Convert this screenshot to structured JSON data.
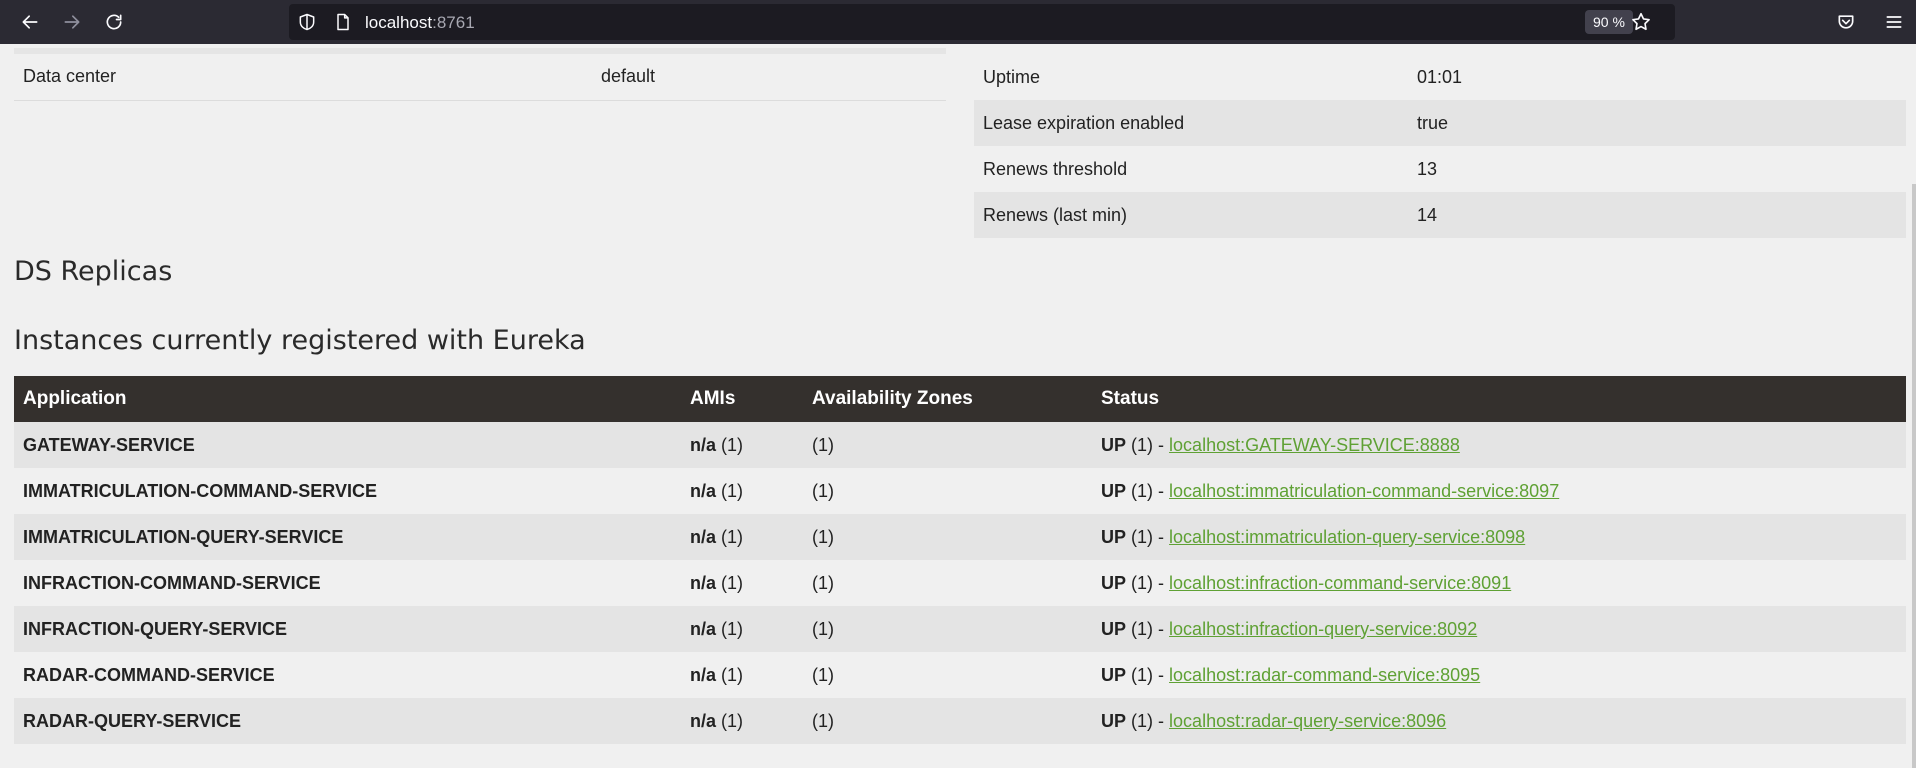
{
  "browser": {
    "url_host": "localhost",
    "url_port": ":8761",
    "zoom": "90 %"
  },
  "info_left": [
    {
      "label": "Data center",
      "value": "default"
    }
  ],
  "info_right": [
    {
      "label": "Uptime",
      "value": "01:01"
    },
    {
      "label": "Lease expiration enabled",
      "value": "true"
    },
    {
      "label": "Renews threshold",
      "value": "13"
    },
    {
      "label": "Renews (last min)",
      "value": "14"
    }
  ],
  "headings": {
    "ds_replicas": "DS Replicas",
    "instances": "Instances currently registered with Eureka"
  },
  "instances_table": {
    "columns": [
      "Application",
      "AMIs",
      "Availability Zones",
      "Status"
    ],
    "rows": [
      {
        "app": "GATEWAY-SERVICE",
        "ami_label": "n/a",
        "ami_count": "(1)",
        "zones": "(1)",
        "status": "UP",
        "status_count": "(1) -",
        "link": "localhost:GATEWAY-SERVICE:8888"
      },
      {
        "app": "IMMATRICULATION-COMMAND-SERVICE",
        "ami_label": "n/a",
        "ami_count": "(1)",
        "zones": "(1)",
        "status": "UP",
        "status_count": "(1) -",
        "link": "localhost:immatriculation-command-service:8097"
      },
      {
        "app": "IMMATRICULATION-QUERY-SERVICE",
        "ami_label": "n/a",
        "ami_count": "(1)",
        "zones": "(1)",
        "status": "UP",
        "status_count": "(1) -",
        "link": "localhost:immatriculation-query-service:8098"
      },
      {
        "app": "INFRACTION-COMMAND-SERVICE",
        "ami_label": "n/a",
        "ami_count": "(1)",
        "zones": "(1)",
        "status": "UP",
        "status_count": "(1) -",
        "link": "localhost:infraction-command-service:8091"
      },
      {
        "app": "INFRACTION-QUERY-SERVICE",
        "ami_label": "n/a",
        "ami_count": "(1)",
        "zones": "(1)",
        "status": "UP",
        "status_count": "(1) -",
        "link": "localhost:infraction-query-service:8092"
      },
      {
        "app": "RADAR-COMMAND-SERVICE",
        "ami_label": "n/a",
        "ami_count": "(1)",
        "zones": "(1)",
        "status": "UP",
        "status_count": "(1) -",
        "link": "localhost:radar-command-service:8095"
      },
      {
        "app": "RADAR-QUERY-SERVICE",
        "ami_label": "n/a",
        "ami_count": "(1)",
        "zones": "(1)",
        "status": "UP",
        "status_count": "(1) -",
        "link": "localhost:radar-query-service:8096"
      }
    ]
  }
}
